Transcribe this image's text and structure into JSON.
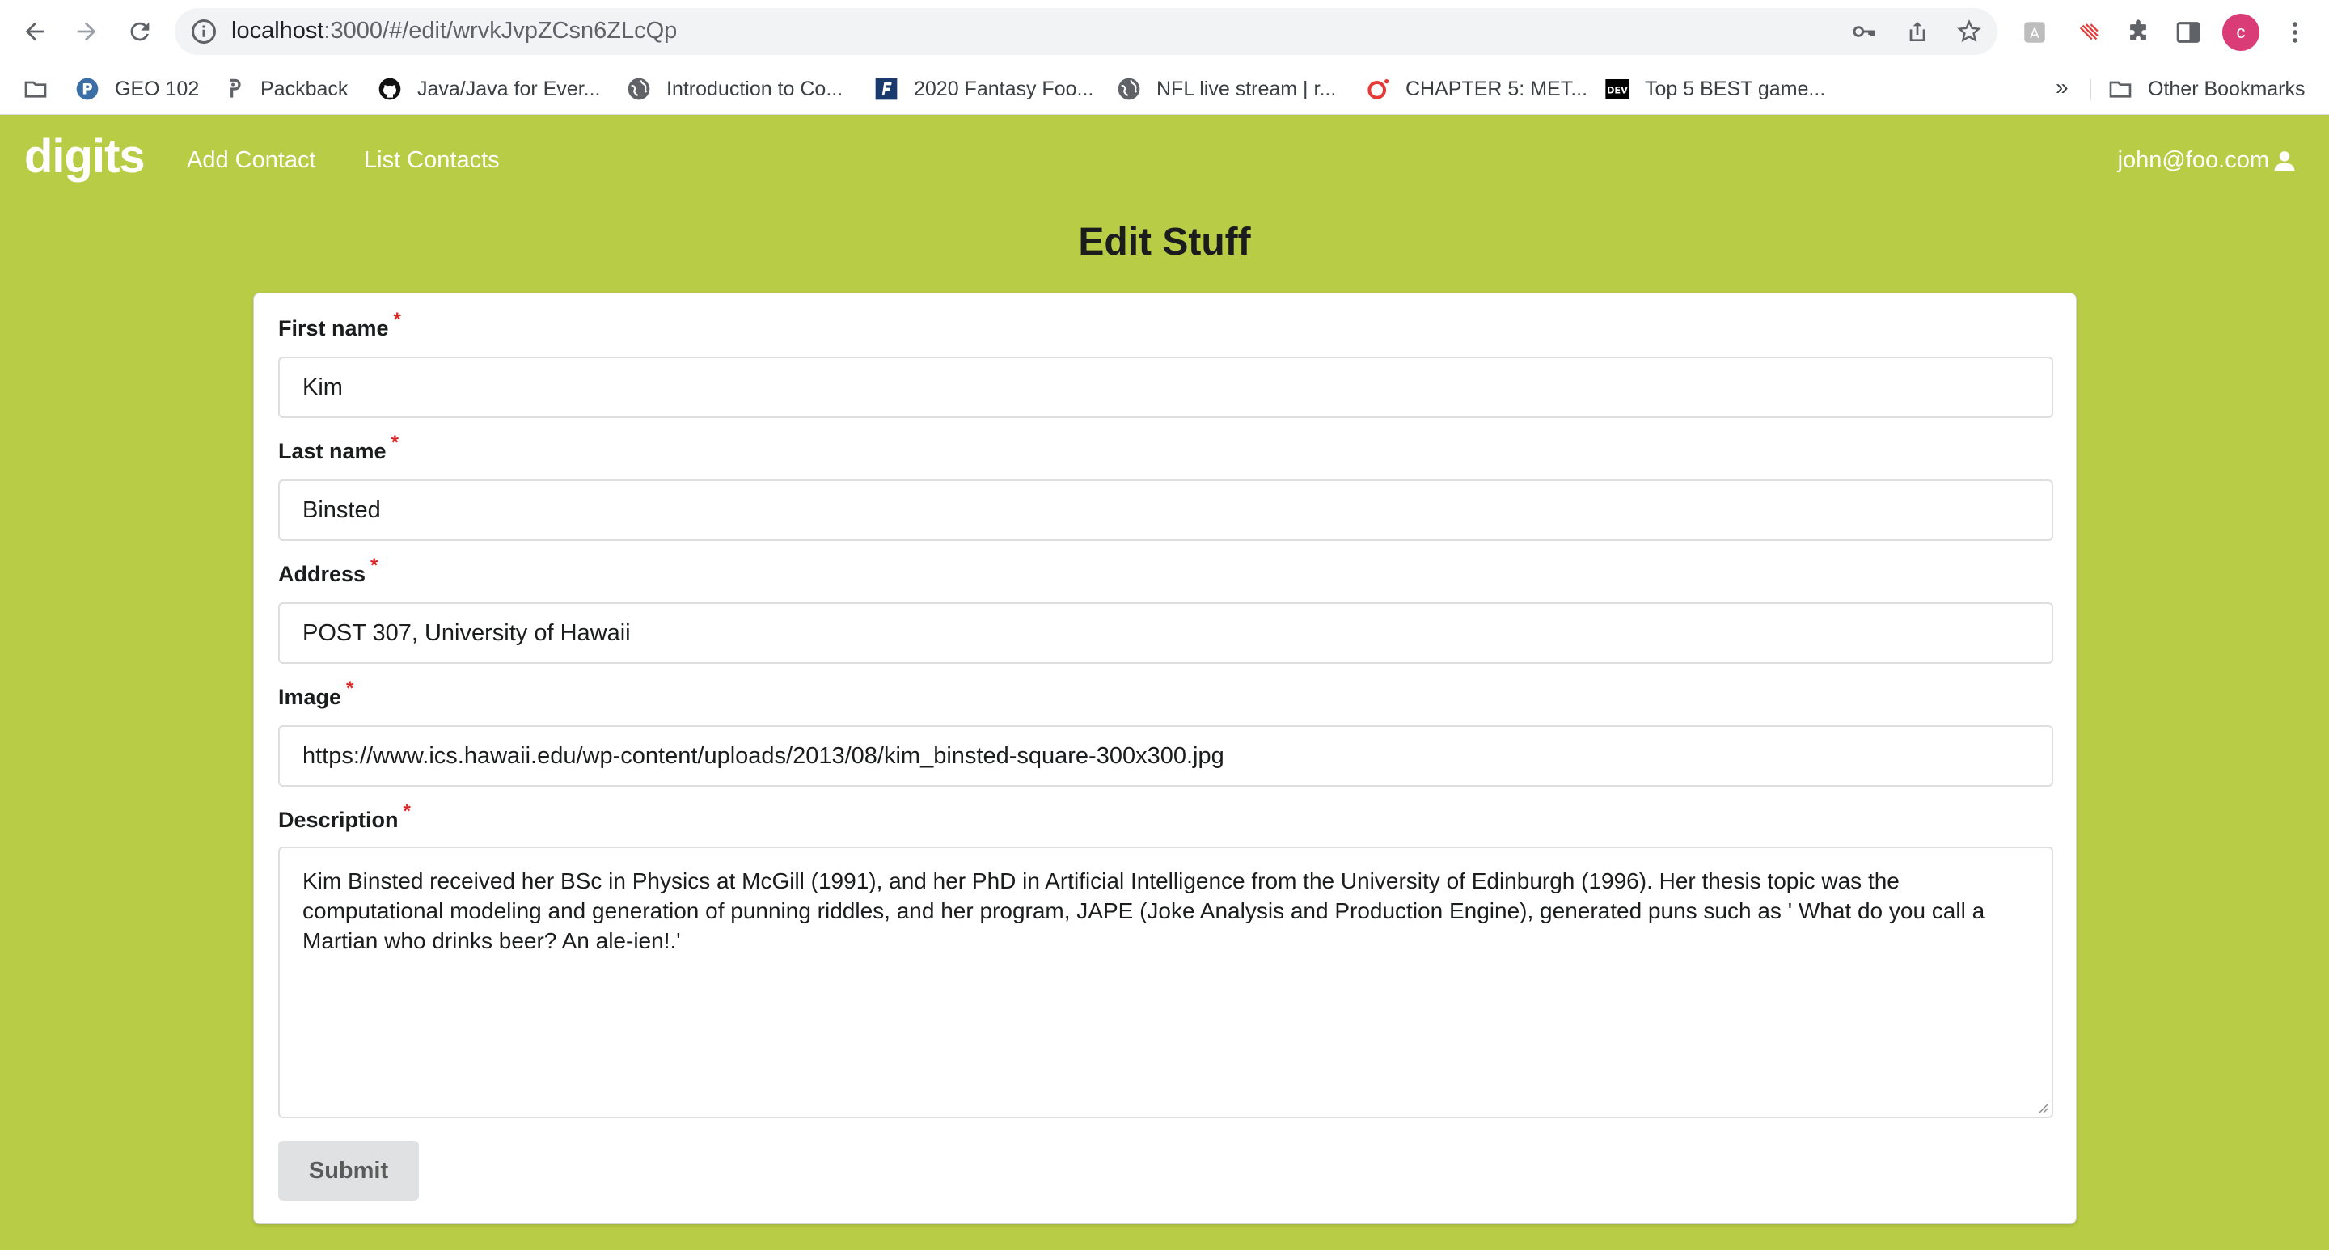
{
  "browser": {
    "url_host": "localhost",
    "url_rest": ":3000/#/edit/wrvkJvpZCsn6ZLcQp",
    "profile_initial": "c"
  },
  "bookmarks": {
    "items": [
      {
        "label": "GEO 102",
        "icon": "pinterest-icon"
      },
      {
        "label": "Packback",
        "icon": "packback-icon"
      },
      {
        "label": "Java/Java for Ever...",
        "icon": "github-icon"
      },
      {
        "label": "Introduction to Co...",
        "icon": "globe-icon"
      },
      {
        "label": "2020 Fantasy Foo...",
        "icon": "fantasy-icon"
      },
      {
        "label": "NFL live stream | r...",
        "icon": "globe-icon"
      },
      {
        "label": "CHAPTER 5: MET...",
        "icon": "opera-icon"
      },
      {
        "label": "Top 5 BEST game...",
        "icon": "dev-icon"
      }
    ],
    "more": "»",
    "other": "Other Bookmarks"
  },
  "nav": {
    "brand": "digits",
    "links": [
      "Add Contact",
      "List Contacts"
    ],
    "user": "john@foo.com"
  },
  "page": {
    "title": "Edit Stuff"
  },
  "form": {
    "required_marker": "*",
    "first_name": {
      "label": "First name",
      "value": "Kim"
    },
    "last_name": {
      "label": "Last name",
      "value": "Binsted"
    },
    "address": {
      "label": "Address",
      "value": "POST 307, University of Hawaii"
    },
    "image": {
      "label": "Image",
      "value": "https://www.ics.hawaii.edu/wp-content/uploads/2013/08/kim_binsted-square-300x300.jpg"
    },
    "description": {
      "label": "Description",
      "lines": [
        "Kim Binsted received her BSc in Physics at McGill (1991), and her PhD in Artificial Intelligence from the University of Edinburgh (1996). Her thesis topic was the",
        "computational modeling and generation of punning riddles, and her program, JAPE (Joke Analysis and Production Engine), generated puns such as ' What do you call a",
        "Martian who drinks beer? An ale-ien!.'"
      ]
    },
    "submit_label": "Submit"
  },
  "colors": {
    "background": "#b9cc45",
    "required": "#db2828",
    "profile": "#d93c77"
  }
}
